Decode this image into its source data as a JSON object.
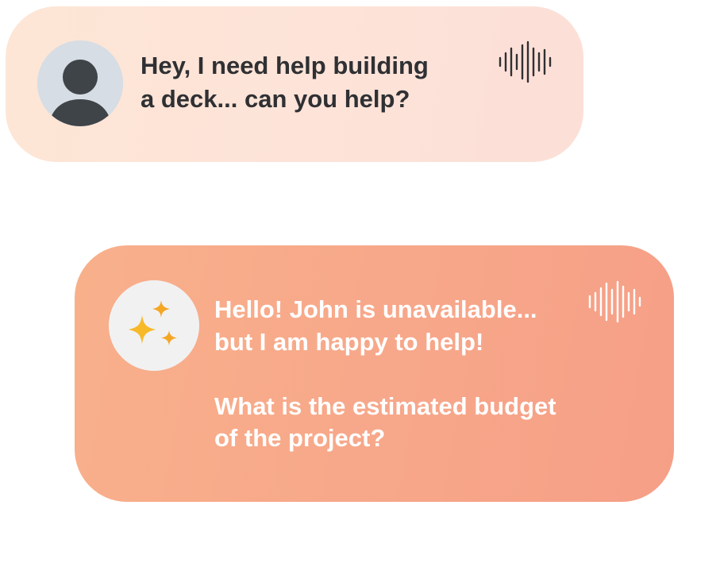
{
  "conversation": {
    "user_message": {
      "lines": [
        "Hey, I need help building",
        "a deck... can you help?"
      ],
      "avatar_icon": "user-silhouette-icon",
      "voice_icon": "audio-waveform-icon"
    },
    "assistant_message": {
      "lines": [
        "Hello! John is unavailable...",
        "but I am happy to help!",
        "What is the estimated budget",
        "of the project?"
      ],
      "avatar_icon": "sparkles-icon",
      "voice_icon": "audio-waveform-icon"
    }
  },
  "colors": {
    "user_bubble": "#fde3d8",
    "assistant_bubble": "#f7a88a",
    "user_text": "#2f3033",
    "assistant_text": "#ffffff",
    "sparkle": "#f7b928",
    "avatar_figure": "#3f4449"
  }
}
